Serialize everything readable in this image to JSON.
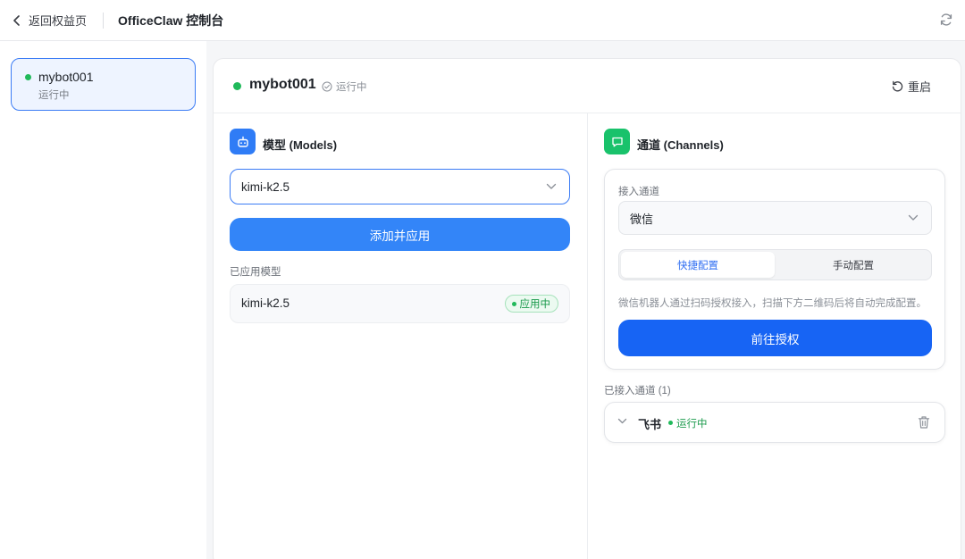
{
  "topbar": {
    "back_label": "返回权益页",
    "title": "OfficeClaw 控制台"
  },
  "sidebar": {
    "bots": [
      {
        "name": "mybot001",
        "status": "运行中"
      }
    ]
  },
  "header": {
    "bot_name": "mybot001",
    "status": "运行中",
    "restart_label": "重启"
  },
  "models": {
    "title": "模型 (Models)",
    "selected_model": "kimi-k2.5",
    "add_button": "添加并应用",
    "applied_label": "已应用模型",
    "applied": [
      {
        "name": "kimi-k2.5",
        "badge": "应用中"
      }
    ]
  },
  "channels": {
    "title": "通道 (Channels)",
    "access_label": "接入通道",
    "selected_channel": "微信",
    "tabs": [
      "快捷配置",
      "手动配置"
    ],
    "active_tab": "快捷配置",
    "hint": "微信机器人通过扫码授权接入，扫描下方二维码后将自动完成配置。",
    "authorize_button": "前往授权",
    "connected_label": "已接入通道 (1)",
    "connected": [
      {
        "name": "飞书",
        "status": "运行中"
      }
    ]
  },
  "colors": {
    "accent": "#2f6ef2",
    "models_button": "#3385f8",
    "authorize_button": "#1764f4",
    "running_green": "#20b95a",
    "models_icon_bg": "#2f7cf6",
    "channels_icon_bg": "#19c26b"
  }
}
